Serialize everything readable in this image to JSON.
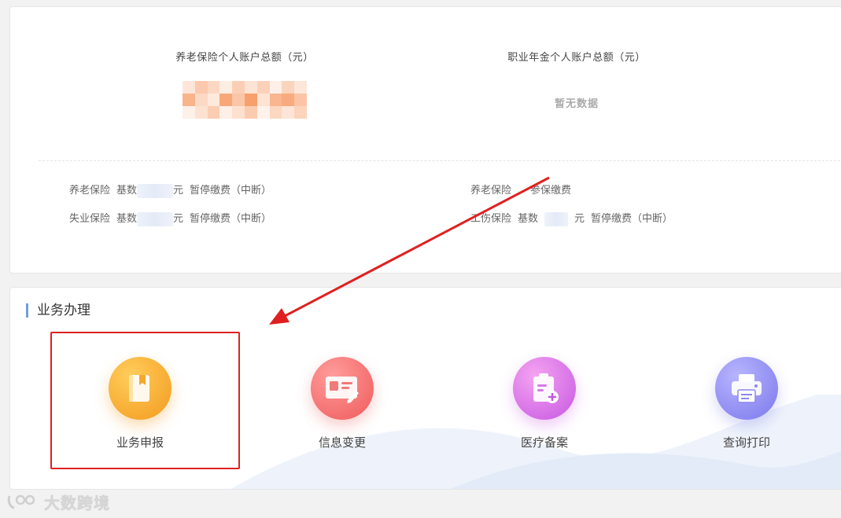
{
  "summary": {
    "pension_total_label": "养老保险个人账户总额（元）",
    "annuity_total_label": "职业年金个人账户总额（元）",
    "annuity_total_value": "暂无数据"
  },
  "insurance": {
    "pension": {
      "name": "养老保险",
      "base_label": "基数",
      "unit": "元",
      "status": "暂停缴费（中断）"
    },
    "unemployment": {
      "name": "失业保险",
      "base_label": "基数",
      "unit": "元",
      "status": "暂停缴费（中断）"
    },
    "pension_right": {
      "name": "养老保险",
      "status": "参保缴费"
    },
    "injury": {
      "name": "工伤保险",
      "base_label": "基数",
      "unit": "元",
      "status": "暂停缴费（中断）"
    }
  },
  "business": {
    "title": "业务办理",
    "tiles": [
      {
        "label": "业务申报",
        "icon": "book-icon"
      },
      {
        "label": "信息变更",
        "icon": "id-card-edit-icon"
      },
      {
        "label": "医疗备案",
        "icon": "clipboard-medical-icon"
      },
      {
        "label": "查询打印",
        "icon": "printer-icon"
      }
    ]
  },
  "watermark": {
    "text": "大数跨境"
  },
  "colors": {
    "accent_bar": "#6f9fe0",
    "highlight": "#e02020",
    "tile_orange": "#f39a1f",
    "tile_red": "#ef5a5a",
    "tile_purple": "#c757e2",
    "tile_indigo": "#7b79ea"
  }
}
